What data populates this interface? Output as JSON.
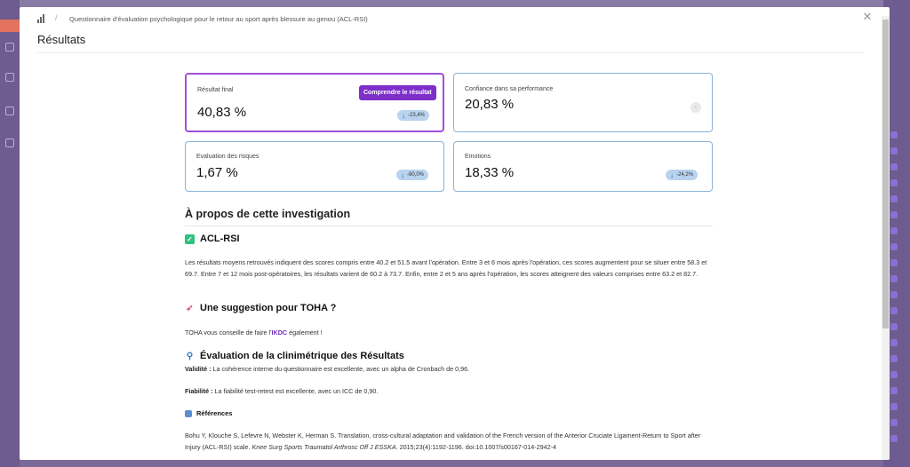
{
  "colors": {
    "accent": "#7d2fc9",
    "card_border": "#8ab2d8",
    "badge_bg": "#b9d3ee",
    "primary_border": "#a14fd8"
  },
  "header": {
    "breadcrumb_separator": "/",
    "breadcrumb": "Questionnaire d'évaluation psychologique pour le retour au sport après blessure au genou (ACL-RSI)",
    "icon": "bar-chart-icon",
    "close_icon": "close-icon"
  },
  "title": "Résultats",
  "cards": [
    {
      "label": "Résultat final",
      "value": "40,83 %",
      "delta": "-23,4%",
      "direction": "down",
      "button_label": "Comprendre le résultat"
    },
    {
      "label": "Confiance dans sa performance",
      "value": "20,83 %",
      "delta": "-"
    },
    {
      "label": "Evaluation des risques",
      "value": "1,67 %",
      "delta": "-80,0%",
      "direction": "down"
    },
    {
      "label": "Emotions",
      "value": "18,33 %",
      "delta": "-24,2%",
      "direction": "down"
    }
  ],
  "about": {
    "title": "À propos de cette investigation",
    "acl_heading": "ACL-RSI",
    "acl_text": "Les résultats moyens retrouvés indiquent des scores compris entre 40.2 et 51.5 avant l'opération. Entre 3 et 6 mois après l'opération, ces scores augmentent pour se situer entre 58.3 et 69.7. Entre 7 et 12 mois post-opératoires, les résultats varient de 60.2 à 73.7. Enfin, entre 2 et 5 ans après l'opération, les scores atteignent des valeurs comprises entre 63.2 et 82.7.",
    "suggestion_heading": "Une suggestion pour TOHA ?",
    "suggestion_prefix": "TOHA vous conseille de faire l'",
    "suggestion_link": "IKDC",
    "suggestion_suffix": " également !",
    "clinimetry_heading": "Évaluation de la clinimétrique des Résultats",
    "validity_label": "Validité :",
    "validity_text": " La cohérence interne du questionnaire est excellente, avec un alpha de Cronbach de 0,96.",
    "reliability_label": "Fiabilité :",
    "reliability_text": " La fiabilité test-retest est excellente, avec un ICC de 0,90.",
    "references_heading": "Références",
    "reference_text": "Bohu Y, Klouche S, Lefevre N, Webster K, Herman S. Translation, cross-cultural adaptation and validation of the French version of the Anterior Cruciate Ligament-Return to Sport after Injury (ACL-RSI) scale. ",
    "reference_journal": "Knee Surg Sports Traumatol Arthrosc Off J ESSKA",
    "reference_tail": ". 2015;23(4):1192-1196. doi:10.1007/s00167-014-2942-4"
  },
  "icons": {
    "check": "check-icon",
    "rocket": "rocket-icon",
    "magnifier": "magnifier-icon",
    "books": "books-icon",
    "arrow_down": "arrow-down-icon"
  }
}
